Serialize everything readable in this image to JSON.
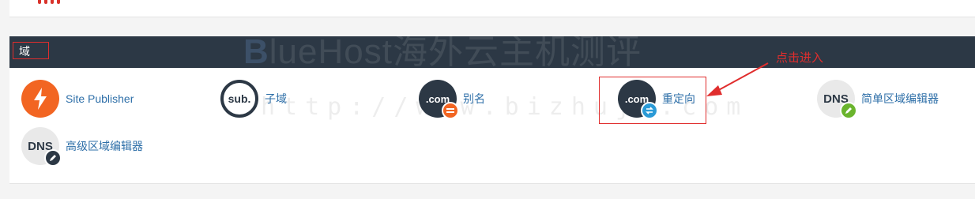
{
  "domains_section": {
    "title": "域",
    "items": [
      {
        "label": "Site Publisher",
        "icon": "lightning-bolt-icon"
      },
      {
        "label": "子域",
        "icon": "sub-icon",
        "icon_text": "sub."
      },
      {
        "label": "别名",
        "icon": "dotcom-alias-icon",
        "icon_text": ".com"
      },
      {
        "label": "重定向",
        "icon": "dotcom-redirect-icon",
        "icon_text": ".com"
      },
      {
        "label": "简单区域编辑器",
        "icon": "dns-simple-icon",
        "icon_text": "DNS"
      },
      {
        "label": "高级区域编辑器",
        "icon": "dns-advanced-icon",
        "icon_text": "DNS"
      }
    ]
  },
  "annotation": {
    "text": "点击进入",
    "color": "#e02d2d"
  },
  "watermark": {
    "logo": "BlueHost海外云主机测评",
    "url": "http://www.bizhuji.com"
  },
  "colors": {
    "header": "#2c3845",
    "accent_orange": "#f26522",
    "link": "#2e6fa8",
    "annotation_red": "#e02d2d"
  }
}
